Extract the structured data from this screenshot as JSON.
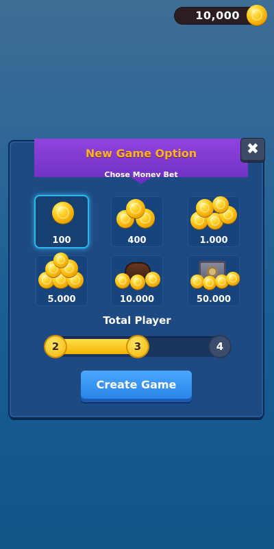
{
  "balance": {
    "amount": "10,000",
    "icon": "coin-icon"
  },
  "dialog": {
    "title": "New Game Option",
    "subtitle": "Chose Money Bet",
    "close_icon": "close-icon"
  },
  "bets": [
    {
      "label": "100",
      "selected": true,
      "icon": "coin-icon"
    },
    {
      "label": "400",
      "selected": false,
      "icon": "coin-stack-icon"
    },
    {
      "label": "1.000",
      "selected": false,
      "icon": "coin-pile-icon"
    },
    {
      "label": "5.000",
      "selected": false,
      "icon": "coin-heap-icon"
    },
    {
      "label": "10.000",
      "selected": false,
      "icon": "treasure-chest-icon"
    },
    {
      "label": "50.000",
      "selected": false,
      "icon": "safe-icon"
    }
  ],
  "total_player": {
    "label": "Total Player",
    "options": [
      "2",
      "3",
      "4"
    ],
    "selected": "3"
  },
  "create_button": {
    "label": "Create Game"
  },
  "colors": {
    "accent": "#ffb02a",
    "selected_glow": "#29b9f0",
    "ribbon": "#7a36cf"
  }
}
